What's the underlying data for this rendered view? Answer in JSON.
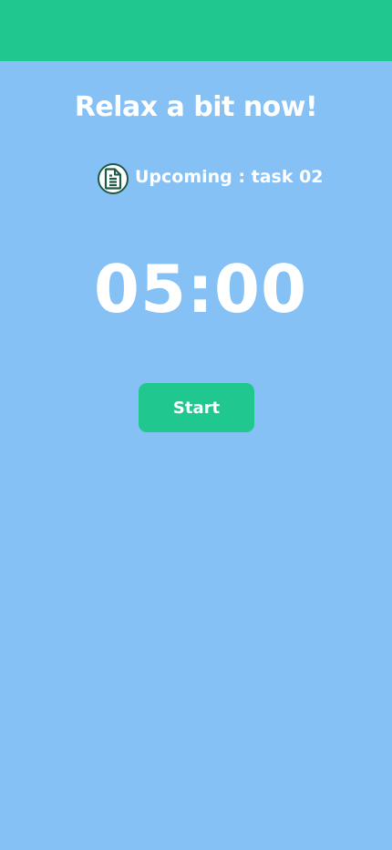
{
  "colors": {
    "background": "#85C1F5",
    "accent": "#20C78F",
    "text": "#FFFFFF",
    "icon": "#1F5A45"
  },
  "header": {
    "title": "Relax a bit now!"
  },
  "upcoming": {
    "icon": "document-icon",
    "label": "Upcoming : task 02"
  },
  "timer": {
    "value": "05:00"
  },
  "controls": {
    "start_label": "Start"
  }
}
